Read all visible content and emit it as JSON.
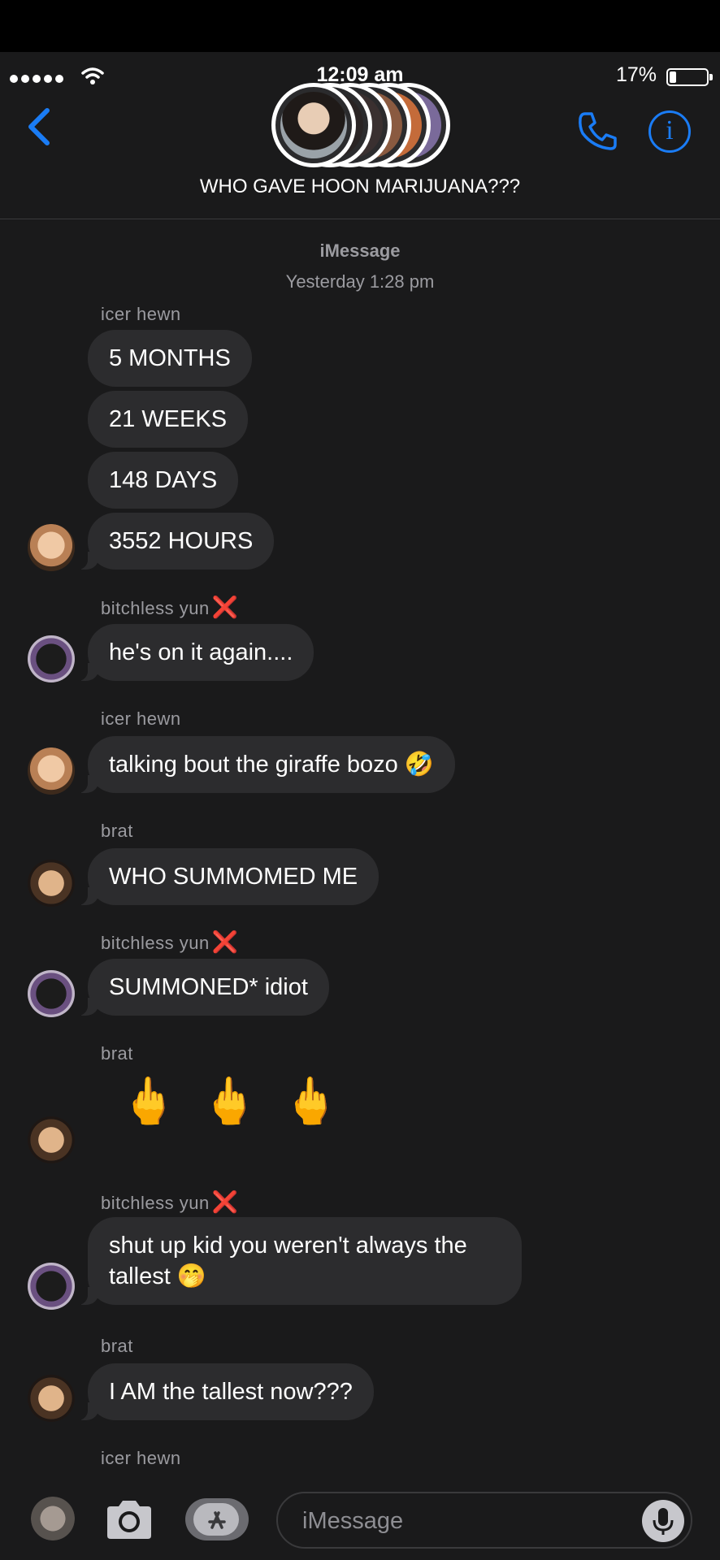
{
  "status_bar": {
    "time": "12:09 am",
    "battery": "17%"
  },
  "header": {
    "title": "WHO GAVE HOON MARIJUANA???"
  },
  "meta": {
    "service": "iMessage",
    "timestamp": "Yesterday 1:28 pm"
  },
  "senders": {
    "hewn": "icer hewn",
    "yun": "bitchless yun",
    "brat": "brat"
  },
  "messages": {
    "m1": "5 MONTHS",
    "m2": "21 WEEKS",
    "m3": "148 DAYS",
    "m4": "3552 HOURS",
    "m5": "he's on it again....",
    "m6": "talking bout the giraffe bozo 🤣",
    "m7": "WHO SUMMOMED ME",
    "m8": "SUMMONED* idiot",
    "m9": "🖕🖕🖕",
    "m10": "shut up kid you weren't always the tallest 🤭",
    "m11": "I AM the tallest now???"
  },
  "marks": {
    "x": "❌"
  },
  "input": {
    "placeholder": "iMessage"
  },
  "icons": [
    "back-chevron-icon",
    "wifi-icon",
    "battery-icon",
    "phone-icon",
    "info-icon",
    "camera-icon",
    "app-store-icon",
    "microphone-icon"
  ],
  "colors": {
    "accent": "#1a7cf5",
    "bubble": "#2c2c2e",
    "background": "#1a1a1b"
  }
}
